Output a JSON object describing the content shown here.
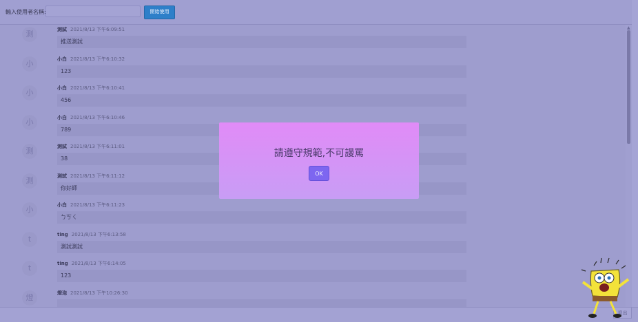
{
  "header": {
    "username_label": "輸入使用者名稱:",
    "username_value": "",
    "start_button": "開始使用"
  },
  "messages": [
    {
      "avatar": "測",
      "name": "測試",
      "time": "2021/8/13 下午6:09:51",
      "text": "推送測試"
    },
    {
      "avatar": "小",
      "name": "小白",
      "time": "2021/8/13 下午6:10:32",
      "text": "123"
    },
    {
      "avatar": "小",
      "name": "小白",
      "time": "2021/8/13 下午6:10:41",
      "text": "456"
    },
    {
      "avatar": "小",
      "name": "小白",
      "time": "2021/8/13 下午6:10:46",
      "text": "789"
    },
    {
      "avatar": "測",
      "name": "測試",
      "time": "2021/8/13 下午6:11:01",
      "text": "38"
    },
    {
      "avatar": "測",
      "name": "測試",
      "time": "2021/8/13 下午6:11:12",
      "text": "你好師"
    },
    {
      "avatar": "小",
      "name": "小白",
      "time": "2021/8/13 下午6:11:23",
      "text": "ㄅㄎㄑ"
    },
    {
      "avatar": "t",
      "name": "ting",
      "time": "2021/8/13 下午6:13:58",
      "text": "測試測試"
    },
    {
      "avatar": "t",
      "name": "ting",
      "time": "2021/8/13 下午6:14:05",
      "text": "123"
    },
    {
      "avatar": "燈",
      "name": "燈泡",
      "time": "2021/8/13 下午10:26:30",
      "text": ""
    }
  ],
  "footer": {
    "leave_button": "退出"
  },
  "modal": {
    "message": "請遵守規範,不可謾罵",
    "ok_label": "OK"
  },
  "colors": {
    "overlay": "#9e9dce",
    "modal_top": "#e18bf7",
    "modal_bottom": "#c89df5",
    "ok_button": "#7d66f0",
    "start_button": "#2e7fc9"
  },
  "sticker": {
    "icon": "spongebob-icon"
  }
}
